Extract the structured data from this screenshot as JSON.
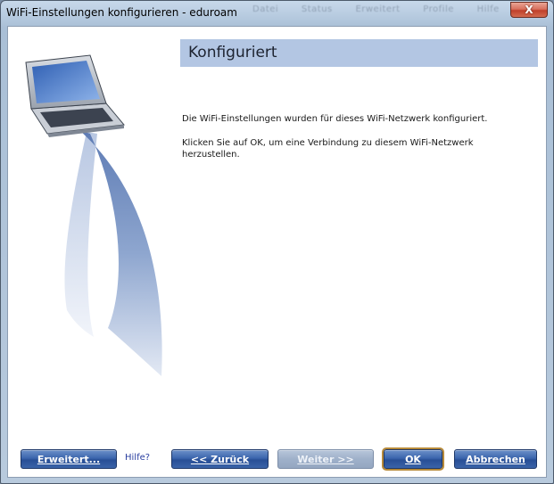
{
  "window": {
    "title": "WiFi-Einstellungen konfigurieren - eduroam",
    "close_glyph": "X",
    "background_menu": [
      "Datei",
      "Status",
      "Erweitert",
      "Profile",
      "Hilfe"
    ]
  },
  "header": {
    "title": "Konfiguriert"
  },
  "body": {
    "line1": "Die WiFi-Einstellungen wurden für dieses WiFi-Netzwerk konfiguriert.",
    "line2": "Klicken Sie auf OK, um eine Verbindung zu diesem WiFi-Netzwerk herzustellen."
  },
  "footer": {
    "advanced_label": "Erweitert...",
    "help_label": "Hilfe?",
    "back_label": "<< Zurück",
    "next_label": "Weiter >>",
    "ok_label": "OK",
    "cancel_label": "Abbrechen"
  },
  "icons": {
    "illustration": "laptop-wifi-illustration-icon",
    "close": "close-icon"
  },
  "colors": {
    "header_banner": "#b3c6e3",
    "button": "#3c66ad",
    "button_disabled": "#a5b6ce",
    "close_button": "#c74a33"
  }
}
